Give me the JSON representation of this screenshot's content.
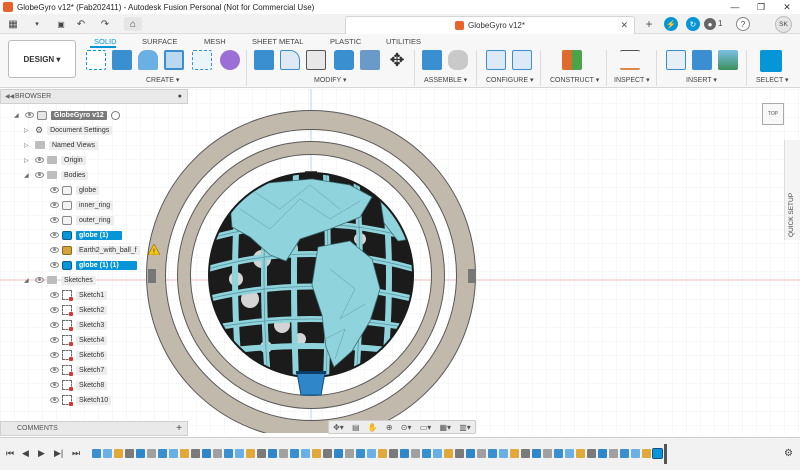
{
  "window": {
    "title": "GlobeGyro v12* (Fab202411) - Autodesk Fusion Personal (Not for Commercial Use)",
    "minimize": "—",
    "maximize": "❐",
    "close": "✕"
  },
  "document_tab": {
    "label": "GlobeGyro v12*",
    "close": "✕",
    "add": "+"
  },
  "quick_access": {
    "grid": "▦",
    "save": "💾",
    "undo": "↶",
    "redo": "↷",
    "home": "⌂"
  },
  "status_icons": {
    "jobs": "1",
    "help": "?",
    "user": "SK"
  },
  "ribbon": {
    "workspace_label": "DESIGN ▾",
    "tabs": [
      "SOLID",
      "SURFACE",
      "MESH",
      "SHEET METAL",
      "PLASTIC",
      "UTILITIES"
    ],
    "active_tab": "SOLID",
    "groups": [
      "CREATE ▾",
      "MODIFY ▾",
      "ASSEMBLE ▾",
      "CONFIGURE ▾",
      "CONSTRUCT ▾",
      "INSPECT ▾",
      "INSERT ▾",
      "SELECT ▾"
    ]
  },
  "browser": {
    "header": "BROWSER",
    "root": "GlobeGyro v12",
    "items": [
      {
        "label": "Document Settings"
      },
      {
        "label": "Named Views"
      },
      {
        "label": "Origin"
      },
      {
        "label": "Bodies"
      },
      {
        "label": "globe"
      },
      {
        "label": "inner_ring"
      },
      {
        "label": "outer_ring"
      },
      {
        "label": "globe (1)"
      },
      {
        "label": "Earth2_with_ball_f"
      },
      {
        "label": "globe (1) (1)"
      },
      {
        "label": "Sketches"
      },
      {
        "label": "Sketch1"
      },
      {
        "label": "Sketch2"
      },
      {
        "label": "Sketch3"
      },
      {
        "label": "Sketch4"
      },
      {
        "label": "Sketch6"
      },
      {
        "label": "Sketch7"
      },
      {
        "label": "Sketch8"
      },
      {
        "label": "Sketch10"
      }
    ]
  },
  "comments": {
    "header": "COMMENTS",
    "add": "+"
  },
  "viewcube": {
    "label": "TOP"
  },
  "quick_setup": {
    "label": "QUICK SETUP"
  },
  "colors": {
    "accent": "#0696d7",
    "ring": "#c2b9ad",
    "globe": "#8fd3dc",
    "selection": "#0696d7"
  }
}
